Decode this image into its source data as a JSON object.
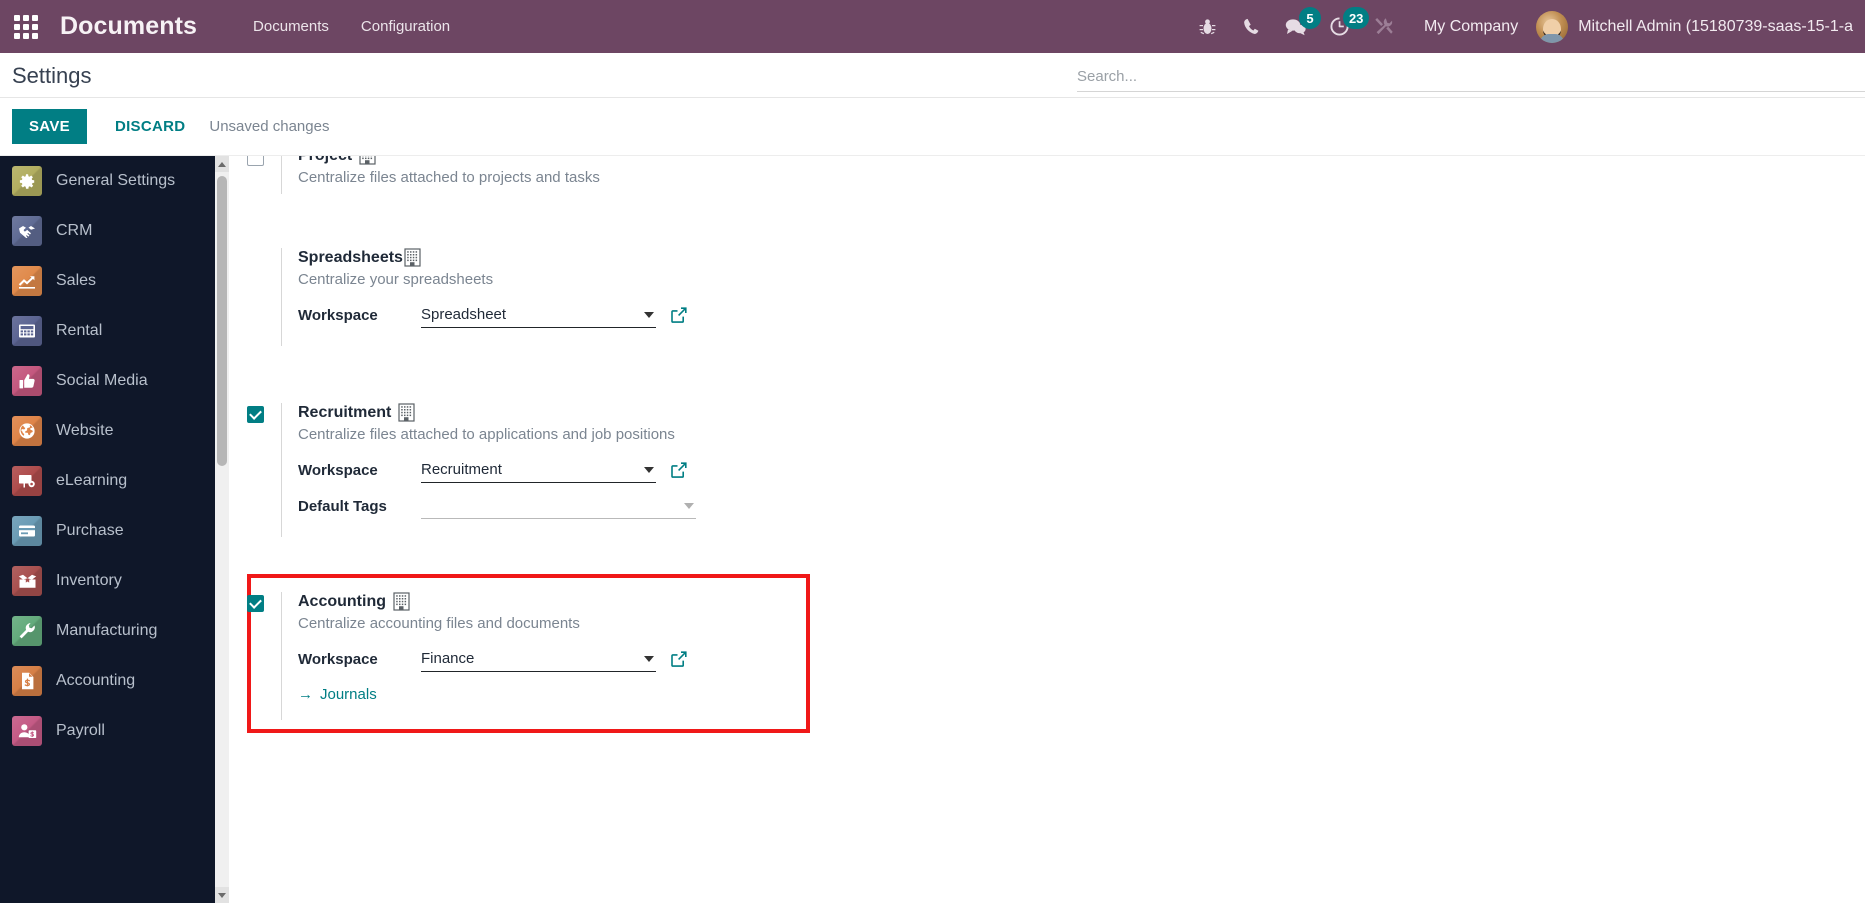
{
  "navbar": {
    "apps_icon": "grid-apps-icon",
    "brand": "Documents",
    "menus": [
      {
        "label": "Documents"
      },
      {
        "label": "Configuration"
      }
    ],
    "sys_icons": [
      {
        "name": "bug-icon",
        "glyph": "🐞",
        "badge": null
      },
      {
        "name": "phone-icon",
        "glyph": "☎",
        "badge": null
      },
      {
        "name": "messages-icon",
        "glyph": "💬",
        "badge": "5"
      },
      {
        "name": "activities-clock-icon",
        "glyph": "◔",
        "badge": "23"
      },
      {
        "name": "tools-icon",
        "glyph": "⚒",
        "badge": null
      }
    ],
    "company": "My Company",
    "user_name": "Mitchell Admin (15180739-saas-15-1-a",
    "accent": "#6d4663",
    "badge_color": "#017e84"
  },
  "control_panel": {
    "title": "Settings",
    "search_placeholder": "Search..."
  },
  "savebar": {
    "save_label": "SAVE",
    "discard_label": "DISCARD",
    "status": "Unsaved changes"
  },
  "sidebar": {
    "items": [
      {
        "label": "General Settings",
        "icon": "gear-icon",
        "color": "#b2ae60"
      },
      {
        "label": "CRM",
        "icon": "handshake-icon",
        "color": "#5f6b94"
      },
      {
        "label": "Sales",
        "icon": "chart-line-icon",
        "color": "#e08a4b"
      },
      {
        "label": "Rental",
        "icon": "calendar-icon",
        "color": "#5b6492"
      },
      {
        "label": "Social Media",
        "icon": "thumbs-up-icon",
        "color": "#c4577e"
      },
      {
        "label": "Website",
        "icon": "globe-icon",
        "color": "#df8448"
      },
      {
        "label": "eLearning",
        "icon": "presentation-icon",
        "color": "#ae4c4c"
      },
      {
        "label": "Purchase",
        "icon": "credit-card-icon",
        "color": "#6a9bb5"
      },
      {
        "label": "Inventory",
        "icon": "box-icon",
        "color": "#a8504f"
      },
      {
        "label": "Manufacturing",
        "icon": "wrench-icon",
        "color": "#63ab7c"
      },
      {
        "label": "Accounting",
        "icon": "invoice-dollar-icon",
        "color": "#d67f46"
      },
      {
        "label": "Payroll",
        "icon": "employee-money-icon",
        "color": "#c45a85"
      }
    ]
  },
  "settings": {
    "blocks": [
      {
        "key": "project",
        "title": "Project",
        "description": "Centralize files attached to projects and tasks",
        "checked": false,
        "enterprise_badge": "enterprise-building-icon",
        "fields": []
      },
      {
        "key": "spreadsheets",
        "title": "Spreadsheets",
        "description": "Centralize your spreadsheets",
        "checked": null,
        "enterprise_badge": "enterprise-building-icon",
        "fields": [
          {
            "label": "Workspace",
            "value": "Spreadsheet",
            "type": "select",
            "external_link": true
          }
        ]
      },
      {
        "key": "recruitment",
        "title": "Recruitment",
        "description": "Centralize files attached to applications and job positions",
        "checked": true,
        "enterprise_badge": "enterprise-building-icon",
        "fields": [
          {
            "label": "Workspace",
            "value": "Recruitment",
            "type": "select",
            "external_link": true
          },
          {
            "label": "Default Tags",
            "value": "",
            "type": "select",
            "external_link": false
          }
        ]
      },
      {
        "key": "accounting",
        "title": "Accounting",
        "description": "Centralize accounting files and documents",
        "checked": true,
        "enterprise_badge": "enterprise-building-icon",
        "highlighted": true,
        "highlight_color": "#f01818",
        "fields": [
          {
            "label": "Workspace",
            "value": "Finance",
            "type": "select",
            "external_link": true
          }
        ],
        "internal_link": {
          "label": "Journals",
          "arrow": "→"
        }
      }
    ]
  }
}
